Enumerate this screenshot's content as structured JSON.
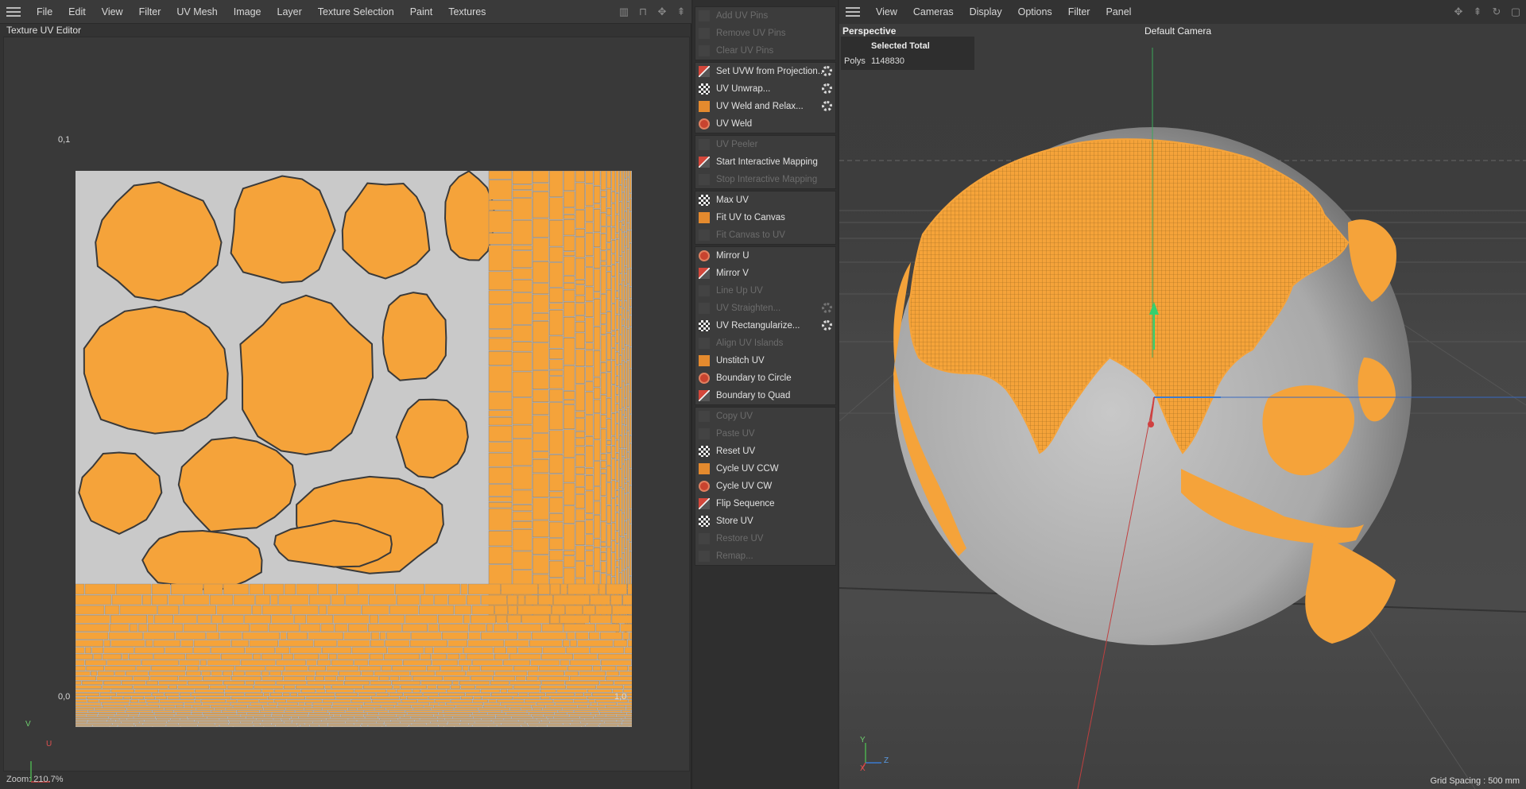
{
  "uv_editor": {
    "menu": [
      "File",
      "Edit",
      "View",
      "Filter",
      "UV Mesh",
      "Image",
      "Layer",
      "Texture Selection",
      "Paint",
      "Textures"
    ],
    "title": "Texture UV Editor",
    "corner_labels": {
      "top_left": "0,1",
      "bottom_left": "0,0",
      "bottom_right": "1,0"
    },
    "zoom": "Zoom: 210.7%",
    "axis": {
      "v": "V",
      "u": "U"
    }
  },
  "commands": {
    "groups": [
      [
        {
          "label": "Add UV Pins",
          "enabled": false
        },
        {
          "label": "Remove UV Pins",
          "enabled": false
        },
        {
          "label": "Clear UV Pins",
          "enabled": false
        }
      ],
      [
        {
          "label": "Set UVW from Projection...",
          "enabled": true,
          "gear": true
        },
        {
          "label": "UV Unwrap...",
          "enabled": true,
          "gear": true
        },
        {
          "label": "UV Weld and Relax...",
          "enabled": true,
          "gear": true
        },
        {
          "label": "UV Weld",
          "enabled": true
        }
      ],
      [
        {
          "label": "UV Peeler",
          "enabled": false
        },
        {
          "label": "Start Interactive Mapping",
          "enabled": true
        },
        {
          "label": "Stop Interactive Mapping",
          "enabled": false
        }
      ],
      [
        {
          "label": "Max UV",
          "enabled": true
        },
        {
          "label": "Fit UV to Canvas",
          "enabled": true
        },
        {
          "label": "Fit Canvas to UV",
          "enabled": false
        }
      ],
      [
        {
          "label": "Mirror U",
          "enabled": true
        },
        {
          "label": "Mirror V",
          "enabled": true
        },
        {
          "label": "Line Up UV",
          "enabled": false
        },
        {
          "label": "UV Straighten...",
          "enabled": false,
          "gear": true
        },
        {
          "label": "UV Rectangularize...",
          "enabled": true,
          "gear": true
        },
        {
          "label": "Align UV Islands",
          "enabled": false
        },
        {
          "label": "Unstitch UV",
          "enabled": true
        },
        {
          "label": "Boundary to Circle",
          "enabled": true
        },
        {
          "label": "Boundary to Quad",
          "enabled": true
        }
      ],
      [
        {
          "label": "Copy UV",
          "enabled": false
        },
        {
          "label": "Paste UV",
          "enabled": false
        },
        {
          "label": "Reset UV",
          "enabled": true
        },
        {
          "label": "Cycle UV CCW",
          "enabled": true
        },
        {
          "label": "Cycle UV CW",
          "enabled": true
        },
        {
          "label": "Flip Sequence",
          "enabled": true
        },
        {
          "label": "Store UV",
          "enabled": true
        },
        {
          "label": "Restore UV",
          "enabled": false
        },
        {
          "label": "Remap...",
          "enabled": false
        }
      ]
    ]
  },
  "viewport": {
    "menu": [
      "View",
      "Cameras",
      "Display",
      "Options",
      "Filter",
      "Panel"
    ],
    "title": "Perspective",
    "camera": "Default Camera",
    "stats": {
      "header": "Selected Total",
      "label": "Polys",
      "value": "1148830"
    },
    "grid_spacing": "Grid Spacing : 500 mm",
    "axis": {
      "y": "Y",
      "z": "Z",
      "x": "X"
    }
  },
  "colors": {
    "accent": "#f5a33a",
    "uv_bg": "#c9c9c9",
    "panel": "#3c3c3c"
  }
}
